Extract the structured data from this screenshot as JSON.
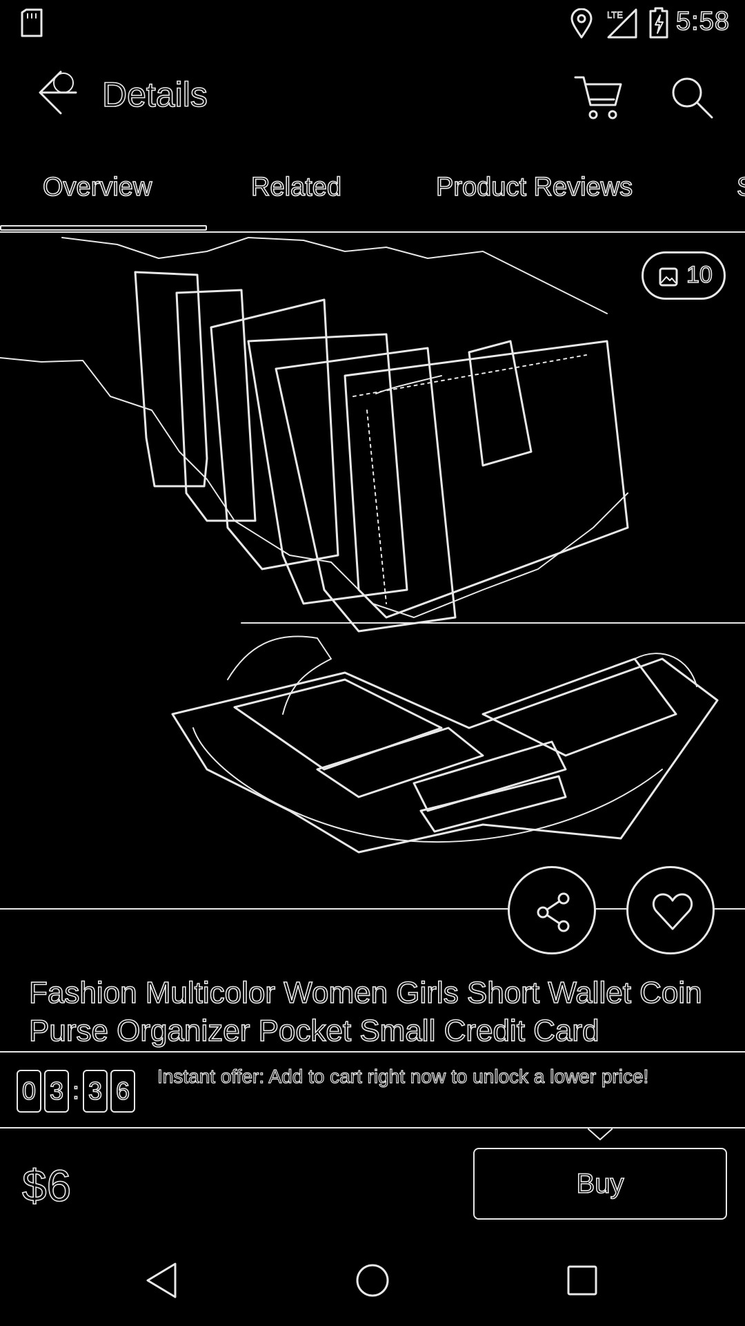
{
  "status_bar": {
    "time": "5:58",
    "icons": [
      "sd-card-icon",
      "location-icon",
      "lte-signal-icon",
      "battery-charging-icon"
    ]
  },
  "app_bar": {
    "title": "Details",
    "icons": [
      "back-arrow-icon",
      "cart-icon",
      "search-icon"
    ]
  },
  "tabs": [
    {
      "label": "Overview",
      "selected": true
    },
    {
      "label": "Related",
      "selected": false
    },
    {
      "label": "Product Reviews",
      "selected": false
    },
    {
      "label": "S",
      "selected": false
    }
  ],
  "gallery": {
    "photo_count": "10",
    "actions": [
      "share-icon",
      "heart-icon"
    ]
  },
  "product": {
    "title": "Fashion Multicolor Women Girls Short Wallet Coin Purse Organizer Pocket Small Credit Card"
  },
  "offer": {
    "countdown": [
      "0",
      "3",
      ":",
      "3",
      "6"
    ],
    "text": "Instant offer: Add to cart right now to unlock a lower price!"
  },
  "purchase": {
    "price": "$6",
    "buy_label": "Buy"
  },
  "nav_bar": {
    "icons": [
      "nav-back-icon",
      "nav-home-icon",
      "nav-recents-icon"
    ]
  },
  "colors": {
    "background": "#000000",
    "stroke": "#e8e8e8"
  }
}
